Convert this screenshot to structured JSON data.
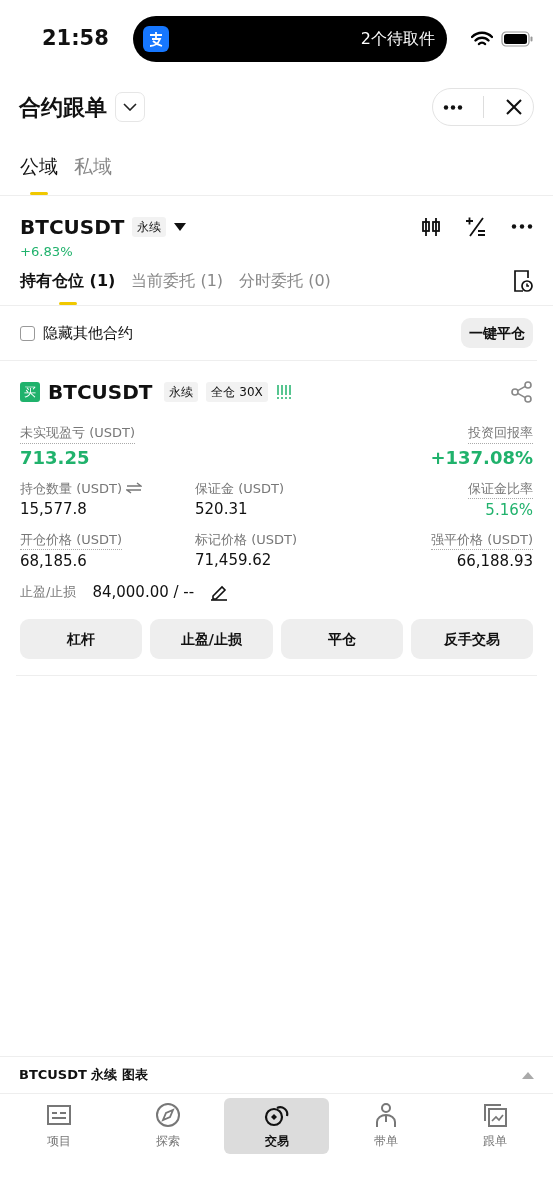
{
  "status_bar": {
    "time": "21:58",
    "island_text": "2个待取件"
  },
  "header": {
    "title": "合约跟单"
  },
  "domain_tabs": [
    {
      "label": "公域",
      "selected": true
    },
    {
      "label": "私域",
      "selected": false
    }
  ],
  "market": {
    "symbol": "BTCUSDT",
    "type_tag": "永续",
    "change": "+6.83%"
  },
  "position_tabs": [
    {
      "label": "持有仓位 (1)",
      "selected": true
    },
    {
      "label": "当前委托 (1)",
      "selected": false
    },
    {
      "label": "分时委托 (0)",
      "selected": false
    }
  ],
  "filter": {
    "label": "隐藏其他合约",
    "checked": false,
    "button": "一键平仓"
  },
  "position": {
    "side": "买",
    "symbol": "BTCUSDT",
    "tags": [
      "永续",
      "全仓 30X"
    ],
    "rows": [
      [
        {
          "label": "未实现盈亏 (USDT)",
          "value": "713.25",
          "positive": true,
          "dotted": true,
          "large": true
        },
        "",
        {
          "label": "投资回报率",
          "value": "+137.08%",
          "positive": true,
          "dotted": true,
          "large": true
        }
      ],
      [
        {
          "label": "持仓数量 (USDT)",
          "value": "15,577.8",
          "positive": false,
          "dotted": false,
          "swap": true
        },
        {
          "label": "保证金 (USDT)",
          "value": "520.31",
          "positive": false,
          "dotted": false
        },
        {
          "label": "保证金比率",
          "value": "5.16%",
          "positive": true,
          "dotted": true
        }
      ],
      [
        {
          "label": "开仓价格 (USDT)",
          "value": "68,185.6",
          "positive": false,
          "dotted": true
        },
        {
          "label": "标记价格 (USDT)",
          "value": "71,459.62",
          "positive": false,
          "dotted": false
        },
        {
          "label": "强平价格 (USDT)",
          "value": "66,188.93",
          "positive": false,
          "dotted": true
        }
      ]
    ],
    "tp_sl": {
      "label": "止盈/止损",
      "value": "84,000.00 / --"
    },
    "actions": [
      "杠杆",
      "止盈/止损",
      "平仓",
      "反手交易"
    ]
  },
  "chart_bar": {
    "label": "BTCUSDT 永续 图表"
  },
  "nav": [
    {
      "label": "项目",
      "kind": "list",
      "selected": false
    },
    {
      "label": "探索",
      "kind": "compass",
      "selected": false
    },
    {
      "label": "交易",
      "kind": "trade",
      "selected": true
    },
    {
      "label": "带单",
      "kind": "person",
      "selected": false
    },
    {
      "label": "跟单",
      "kind": "chart",
      "selected": false
    }
  ]
}
